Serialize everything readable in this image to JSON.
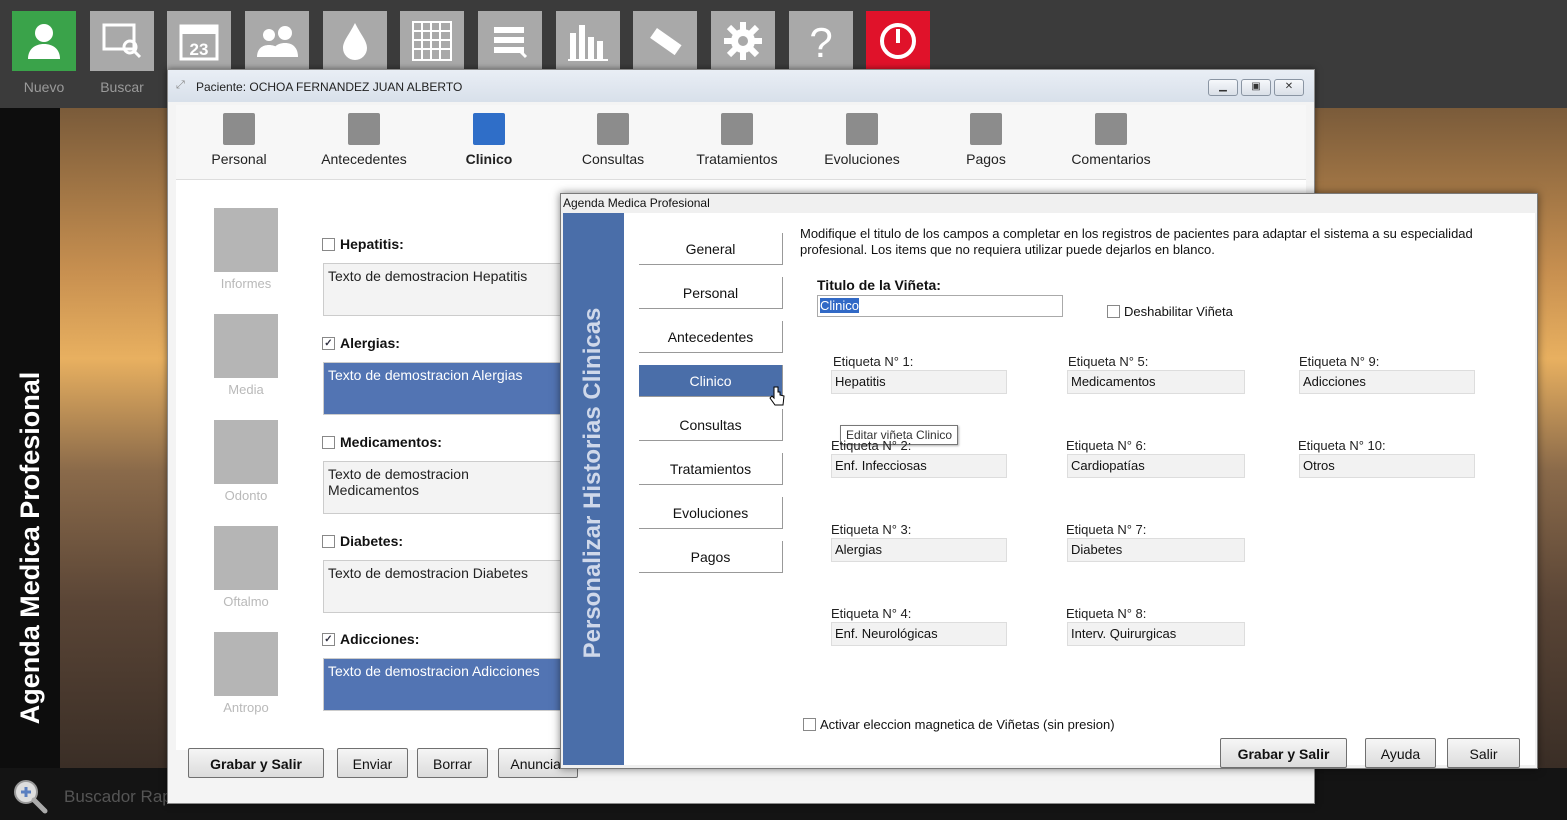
{
  "toolbar": {
    "buttons": [
      {
        "label": "Nuevo",
        "icon": "user-icon"
      },
      {
        "label": "Buscar",
        "icon": "search-screen-icon"
      },
      {
        "label": "",
        "icon": "calendar-icon"
      },
      {
        "label": "",
        "icon": "users-icon"
      },
      {
        "label": "",
        "icon": "drop-icon"
      },
      {
        "label": "",
        "icon": "grid-icon"
      },
      {
        "label": "",
        "icon": "list-icon"
      },
      {
        "label": "",
        "icon": "chart-icon"
      },
      {
        "label": "",
        "icon": "usb-icon"
      },
      {
        "label": "",
        "icon": "gear-icon"
      },
      {
        "label": "",
        "icon": "help-icon"
      },
      {
        "label": "",
        "icon": "power-icon"
      }
    ],
    "calendar_day": "23"
  },
  "sidebar": {
    "title": "Agenda Medica Profesional"
  },
  "bottombar": {
    "search_label": "Buscador Rapido"
  },
  "patient_window": {
    "title": "Paciente: OCHOA FERNANDEZ JUAN ALBERTO",
    "tabs": [
      "Personal",
      "Antecedentes",
      "Clinico",
      "Consultas",
      "Tratamientos",
      "Evoluciones",
      "Pagos",
      "Comentarios"
    ],
    "active_tab": "Clinico",
    "side_items": [
      "Informes",
      "Media",
      "Odonto",
      "Oftalmo",
      "Antropo"
    ],
    "fields": [
      {
        "label": "Hepatitis:",
        "checked": false,
        "text": "Texto de demostracion Hepatitis",
        "selected": false
      },
      {
        "label": "Alergias:",
        "checked": true,
        "text": "Texto de demostracion Alergias",
        "selected": true
      },
      {
        "label": "Medicamentos:",
        "checked": false,
        "text": "Texto de demostracion Medicamentos",
        "selected": false
      },
      {
        "label": "Diabetes:",
        "checked": false,
        "text": "Texto de demostracion Diabetes",
        "selected": false
      },
      {
        "label": "Adicciones:",
        "checked": true,
        "text": "Texto de demostracion Adicciones",
        "selected": true
      }
    ],
    "buttons": {
      "save": "Grabar y Salir",
      "send": "Enviar",
      "delete": "Borrar",
      "announce": "Anunciar"
    }
  },
  "dialog": {
    "title": "Agenda Medica Profesional",
    "side_title": "Personalizar Historias Clinicas",
    "nav": [
      "General",
      "Personal",
      "Antecedentes",
      "Clinico",
      "Consultas",
      "Tratamientos",
      "Evoluciones",
      "Pagos"
    ],
    "active_nav": "Clinico",
    "tooltip": "Editar viñeta Clinico",
    "description": "Modifique el titulo de los campos a completar en los registros de pacientes para adaptar el sistema a su especialidad profesional. Los items que no requiera utilizar puede dejarlos en blanco.",
    "title_label": "Titulo de la Viñeta:",
    "title_value": "Clinico",
    "disable_label": "Deshabilitar Viñeta",
    "labels": [
      {
        "label": "Etiqueta N° 1:",
        "value": "Hepatitis"
      },
      {
        "label": "Etiqueta N° 2:",
        "value": "Enf. Infecciosas"
      },
      {
        "label": "Etiqueta N° 3:",
        "value": "Alergias"
      },
      {
        "label": "Etiqueta N° 4:",
        "value": "Enf. Neurológicas"
      },
      {
        "label": "Etiqueta N° 5:",
        "value": "Medicamentos"
      },
      {
        "label": "Etiqueta N° 6:",
        "value": "Cardiopatías"
      },
      {
        "label": "Etiqueta N° 7:",
        "value": "Diabetes"
      },
      {
        "label": "Etiqueta N° 8:",
        "value": "Interv. Quirurgicas"
      },
      {
        "label": "Etiqueta N° 9:",
        "value": "Adicciones"
      },
      {
        "label": "Etiqueta N° 10:",
        "value": "Otros"
      }
    ],
    "magnetic_label": "Activar eleccion magnetica de Viñetas (sin presion)",
    "buttons": {
      "save": "Grabar y Salir",
      "help": "Ayuda",
      "exit": "Salir"
    }
  },
  "colors": {
    "accent": "#4a6ea9",
    "power": "#e0122a",
    "nuevo": "#3aa34a"
  }
}
